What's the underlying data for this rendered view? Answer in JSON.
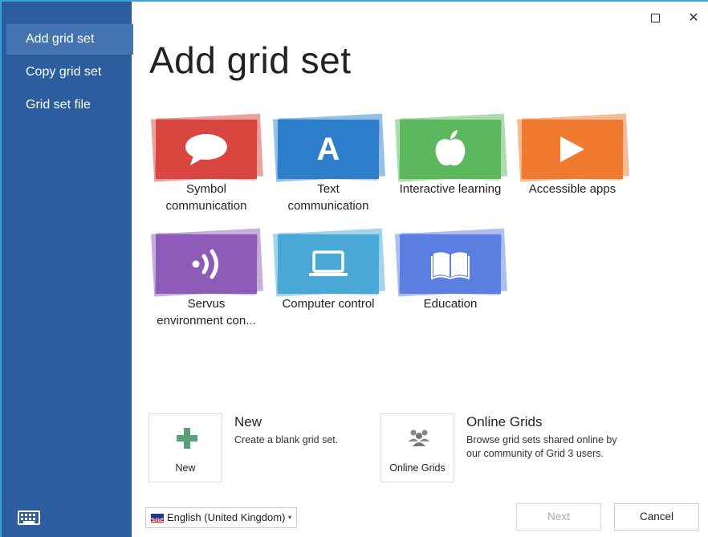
{
  "window": {
    "maximize_glyph": "☐",
    "close_glyph": "✕"
  },
  "sidebar": {
    "items": [
      {
        "label": "Add grid set",
        "active": true
      },
      {
        "label": "Copy grid set",
        "active": false
      },
      {
        "label": "Grid set file",
        "active": false
      }
    ],
    "keyboard_icon": "keyboard-icon"
  },
  "page": {
    "title": "Add grid set"
  },
  "categories": [
    {
      "label_line1": "Symbol",
      "label_line2": "communication",
      "color": "#d8463f",
      "icon": "speech-bubble-icon"
    },
    {
      "label_line1": "Text",
      "label_line2": "communication",
      "color": "#2d7fcb",
      "icon": "letter-a-icon",
      "icon_text": "A"
    },
    {
      "label_line1": "Interactive learning",
      "label_line2": "",
      "color": "#5cb85c",
      "icon": "apple-icon"
    },
    {
      "label_line1": "Accessible apps",
      "label_line2": "",
      "color": "#f07a30",
      "icon": "play-icon"
    },
    {
      "label_line1": "Servus",
      "label_line2": "environment con...",
      "color": "#8e5bb8",
      "icon": "signal-icon"
    },
    {
      "label_line1": "Computer control",
      "label_line2": "",
      "color": "#4aa8d6",
      "icon": "laptop-icon"
    },
    {
      "label_line1": "Education",
      "label_line2": "",
      "color": "#5a7fe0",
      "icon": "book-icon"
    }
  ],
  "actions": {
    "new": {
      "button_label": "New",
      "heading": "New",
      "description": "Create a blank grid set.",
      "icon": "plus-icon",
      "color": "#5a9e7a"
    },
    "online": {
      "button_label": "Online Grids",
      "heading": "Online Grids",
      "description_line1": "Browse grid sets shared online by",
      "description_line2": "our community of Grid 3 users.",
      "icon": "people-icon"
    }
  },
  "footer": {
    "language": "English (United Kingdom)",
    "caret": "▾",
    "next_label": "Next",
    "cancel_label": "Cancel"
  }
}
